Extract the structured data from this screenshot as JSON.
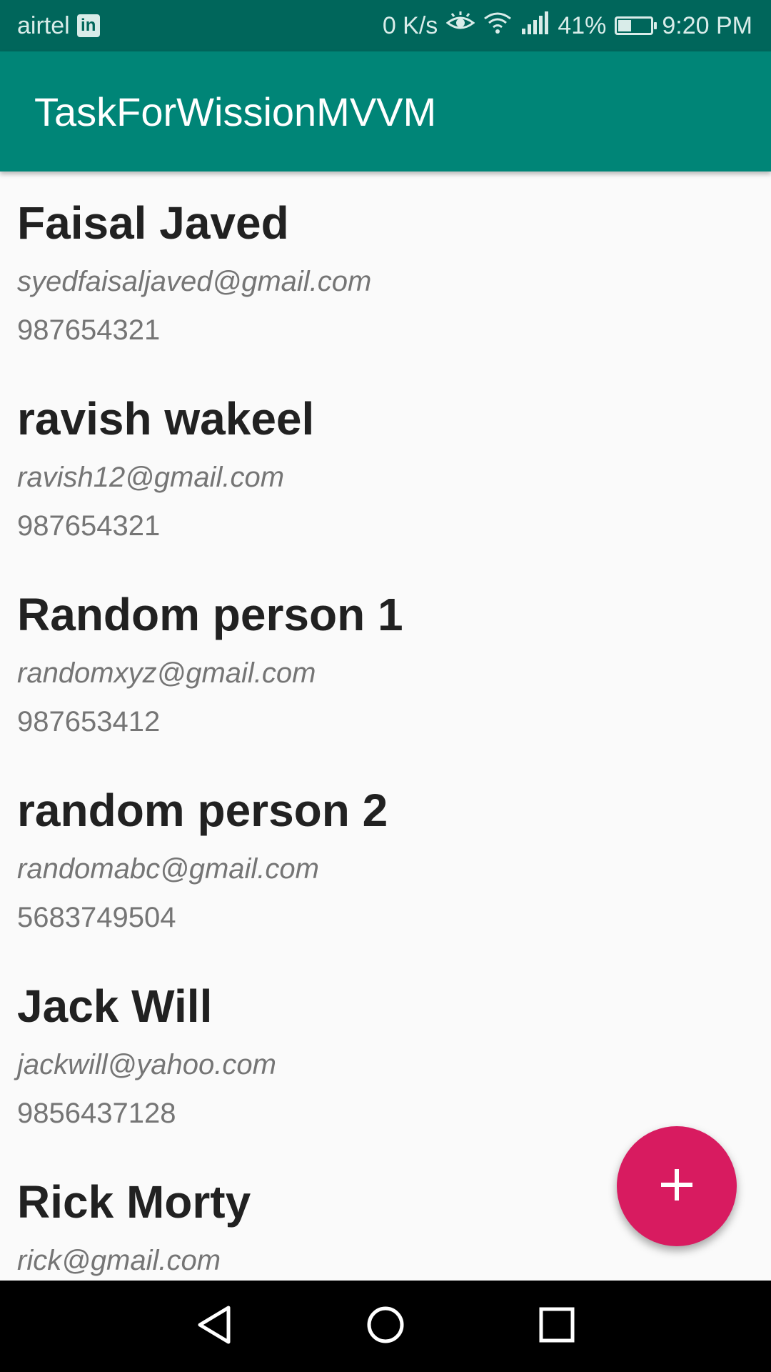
{
  "status_bar": {
    "carrier": "airtel",
    "linkedin_badge": "in",
    "net_speed": "0 K/s",
    "battery_percent": "41%",
    "battery_level": 0.41,
    "time": "9:20 PM",
    "icons": [
      "linkedin-icon",
      "eye-comfort-icon",
      "wifi-icon",
      "signal-icon",
      "battery-charging-icon"
    ],
    "color": "#00665b"
  },
  "app_bar": {
    "title": "TaskForWissionMVVM",
    "color": "#008577"
  },
  "contacts": [
    {
      "name": "Faisal Javed",
      "email": "syedfaisaljaved@gmail.com",
      "phone": "987654321"
    },
    {
      "name": "ravish wakeel",
      "email": "ravish12@gmail.com",
      "phone": "987654321"
    },
    {
      "name": "Random person 1",
      "email": "randomxyz@gmail.com",
      "phone": "987653412"
    },
    {
      "name": "random person 2",
      "email": "randomabc@gmail.com",
      "phone": "5683749504"
    },
    {
      "name": "Jack Will",
      "email": "jackwill@yahoo.com",
      "phone": "9856437128"
    },
    {
      "name": "Rick Morty",
      "email": "rick@gmail.com",
      "phone": ""
    }
  ],
  "fab": {
    "icon": "plus-icon",
    "color": "#d81b60"
  },
  "nav_bar": {
    "buttons": [
      "back-icon",
      "home-icon",
      "recents-icon"
    ]
  }
}
